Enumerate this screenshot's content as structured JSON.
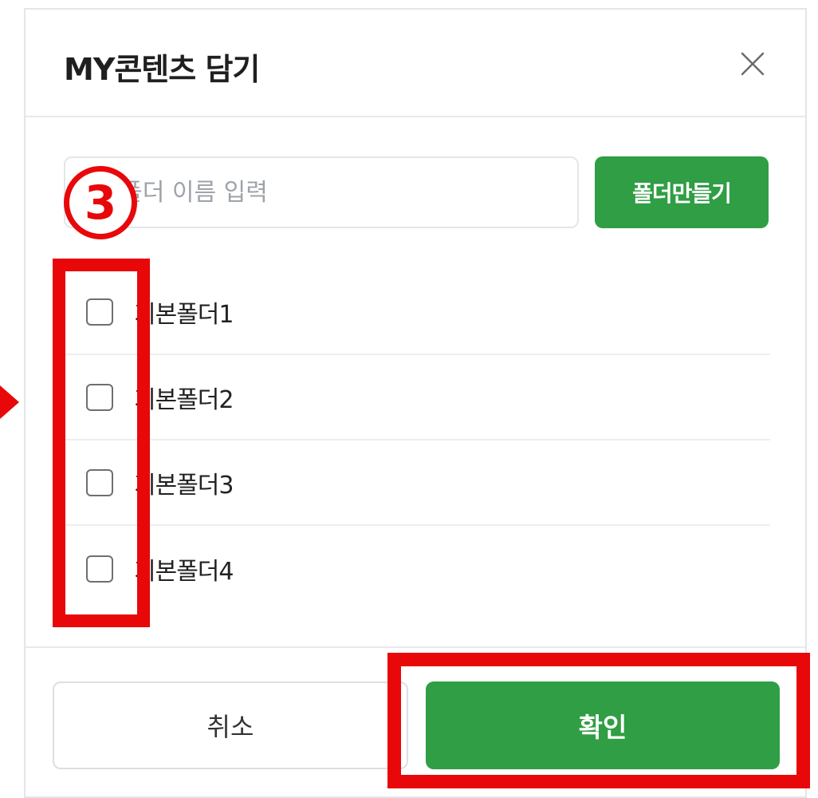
{
  "dialog": {
    "title": "MY콘텐츠 담기",
    "close_icon": "close-icon"
  },
  "new_folder": {
    "placeholder": "새 폴더 이름 입력",
    "value": "",
    "create_label": "폴더만들기"
  },
  "folders": [
    {
      "label": "기본폴더1",
      "checked": false
    },
    {
      "label": "기본폴더2",
      "checked": false
    },
    {
      "label": "기본폴더3",
      "checked": false
    },
    {
      "label": "기본폴더4",
      "checked": false
    }
  ],
  "footer": {
    "cancel_label": "취소",
    "confirm_label": "확인"
  },
  "annotations": {
    "step_number": "3",
    "highlight_color": "#e8080a"
  },
  "colors": {
    "accent_green": "#2f9e44",
    "border": "#e3e6ea"
  }
}
